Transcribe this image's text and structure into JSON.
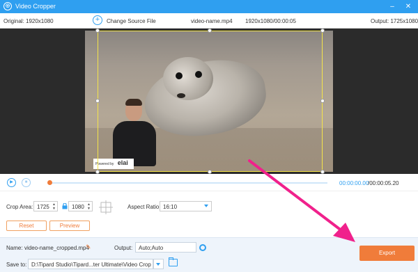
{
  "window": {
    "title": "Video Cropper",
    "controls": {
      "minimize": "–",
      "close": "✕"
    }
  },
  "infobar": {
    "original": "Original: 1920x1080",
    "change_source": "Change Source File",
    "filename": "video-name.mp4",
    "resolution_duration": "1920x1080/00:00:05",
    "output": "Output: 1725x1080"
  },
  "preview": {
    "watermark_small": "Powered by",
    "watermark_brand": "elai"
  },
  "playback": {
    "progress": 0,
    "time_current": "00:00:00.00",
    "time_total": "/00:00:05.20"
  },
  "crop": {
    "label": "Crop Area:",
    "width": "1725",
    "height": "1080",
    "aspect_label": "Aspect Ratio:",
    "aspect_value": "16:10",
    "reset": "Reset",
    "preview": "Preview"
  },
  "output": {
    "name_label": "Name:",
    "name_value": "video-name_cropped.mp4",
    "output_label": "Output:",
    "output_value": "Auto;Auto",
    "save_label": "Save to:",
    "save_path": "D:\\Tipard Studio\\Tipard...ter Ultimate\\Video Crop",
    "export": "Export"
  },
  "colors": {
    "accent": "#2f9ff0",
    "export": "#f07c3a",
    "crop_frame": "#f5e54a",
    "annotation_arrow": "#f0218c"
  }
}
